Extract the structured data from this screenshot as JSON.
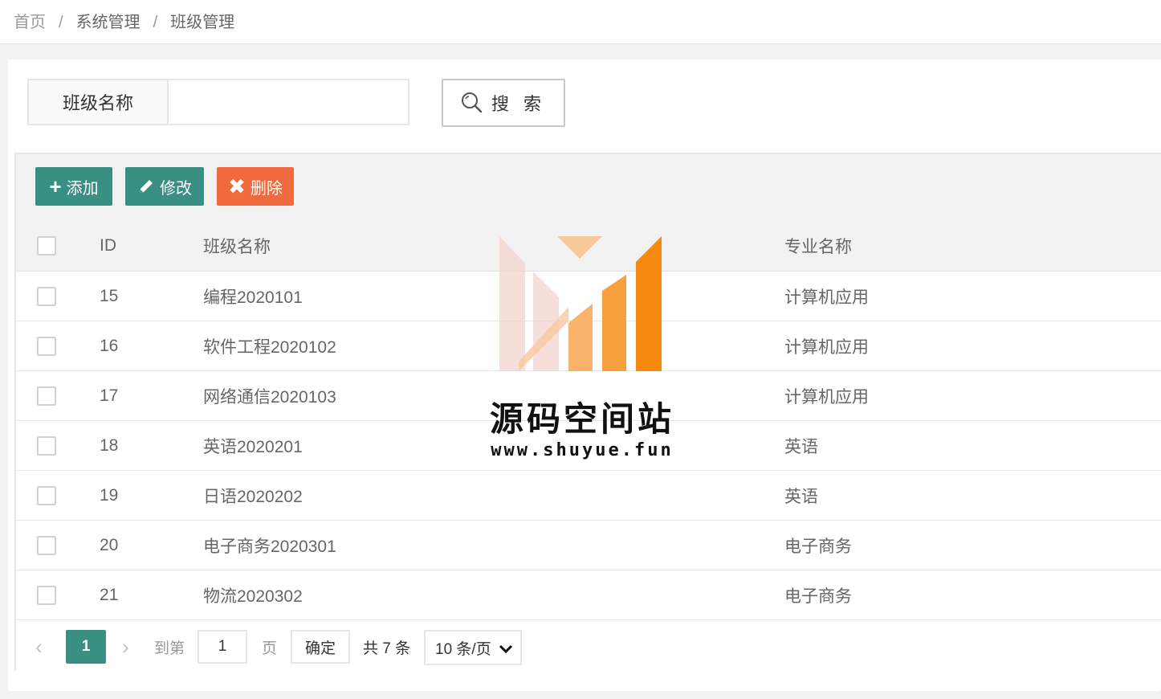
{
  "breadcrumb": {
    "home": "首页",
    "sep": "/",
    "system": "系统管理",
    "current": "班级管理"
  },
  "search": {
    "label": "班级名称",
    "value": "",
    "placeholder": "",
    "button": "搜 索"
  },
  "toolbar": {
    "add": "添加",
    "edit": "修改",
    "delete": "删除"
  },
  "table": {
    "headers": {
      "id": "ID",
      "name": "班级名称",
      "major": "专业名称"
    },
    "rows": [
      {
        "id": "15",
        "name": "编程2020101",
        "major": "计算机应用"
      },
      {
        "id": "16",
        "name": "软件工程2020102",
        "major": "计算机应用"
      },
      {
        "id": "17",
        "name": "网络通信2020103",
        "major": "计算机应用"
      },
      {
        "id": "18",
        "name": "英语2020201",
        "major": "英语"
      },
      {
        "id": "19",
        "name": "日语2020202",
        "major": "英语"
      },
      {
        "id": "20",
        "name": "电子商务2020301",
        "major": "电子商务"
      },
      {
        "id": "21",
        "name": "物流2020302",
        "major": "电子商务"
      }
    ]
  },
  "pager": {
    "prev": "‹",
    "current": "1",
    "next": "›",
    "goto_label": "到第",
    "goto_value": "1",
    "page_label": "页",
    "confirm": "确定",
    "total": "共 7 条",
    "page_size": "10 条/页"
  },
  "watermark": {
    "title": "源码空间站",
    "url": "www.shuyue.fun"
  },
  "colors": {
    "primary": "#3a8f83",
    "danger": "#ef6a3c",
    "background": "#f2f2f2"
  }
}
